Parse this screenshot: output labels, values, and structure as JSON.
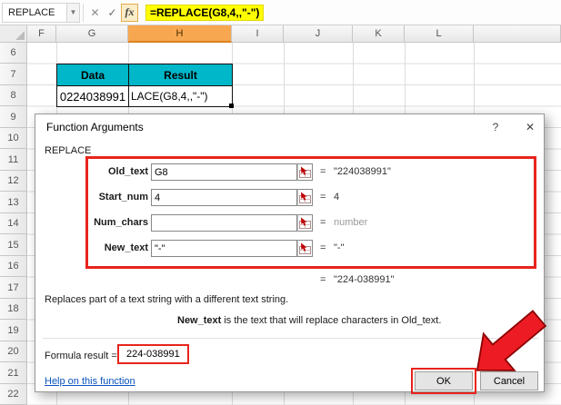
{
  "colors": {
    "formula_highlight": "#ffff00",
    "table_header_fill": "#00b6c9",
    "selected_column_fill": "#f8a751",
    "annotation_red": "#e8231d",
    "link_blue": "#0a52bd"
  },
  "name_box": {
    "value": "REPLACE",
    "dropdown_icon": "▼"
  },
  "formula_bar": {
    "cancel": "✕",
    "enter": "✓",
    "fx": "fx",
    "formula": "=REPLACE(G8,4,,\"-\")"
  },
  "grid": {
    "col_headers": [
      "F",
      "G",
      "H",
      "I",
      "J",
      "K",
      "L"
    ],
    "row_headers": [
      "6",
      "7",
      "8",
      "9",
      "10",
      "11",
      "12",
      "13",
      "14",
      "15",
      "16",
      "17",
      "18",
      "19",
      "20",
      "21",
      "22"
    ],
    "table": {
      "data_header": "Data",
      "result_header": "Result",
      "data_value": "0224038991",
      "result_cell_text": "LACE(G8,4,,\"-\")"
    }
  },
  "dialog": {
    "title": "Function Arguments",
    "help_button": "?",
    "close_button": "✕",
    "function_name": "REPLACE",
    "fields": [
      {
        "label": "Old_text",
        "value": "G8",
        "equals": "=",
        "result": "\"224038991\""
      },
      {
        "label": "Start_num",
        "value": "4",
        "equals": "=",
        "result": "4"
      },
      {
        "label": "Num_chars",
        "value": "",
        "equals": "=",
        "result": "number"
      },
      {
        "label": "New_text",
        "value": "\"-\"",
        "equals": "=",
        "result": "\"-\""
      }
    ],
    "intermediate_equals": "=",
    "intermediate_result": "\"224-038991\"",
    "description": "Replaces part of a text string with a different text string.",
    "arg_help_name": "New_text",
    "arg_help_text": "  is the text that will replace characters in Old_text.",
    "formula_result_label": "Formula result =",
    "formula_result_value": "224-038991",
    "help_link": "Help on this function",
    "ok": "OK",
    "cancel": "Cancel"
  }
}
